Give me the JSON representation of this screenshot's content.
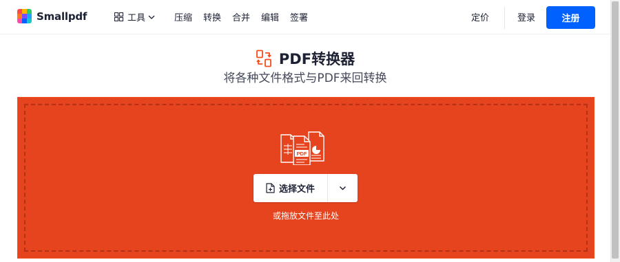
{
  "header": {
    "logo_text": "Smallpdf",
    "tools_label": "工具",
    "nav": [
      "压缩",
      "转换",
      "合并",
      "编辑",
      "签署"
    ],
    "pricing": "定价",
    "login": "登录",
    "signup": "注册"
  },
  "page": {
    "title": "PDF转换器",
    "subtitle": "将各种文件格式与PDF来回转换"
  },
  "dropzone": {
    "choose_label": "选择文件",
    "hint": "或拖放文件至此处",
    "pdf_badge": "PDF"
  },
  "colors": {
    "accent": "#0061fe",
    "dropzone": "#e5441f",
    "title_icon": "#f24e1e"
  },
  "icons": {
    "logo": "smallpdf-logo-icon",
    "tools": "grid-icon",
    "tools_chevron": "chevron-down-icon",
    "title": "convert-arrows-icon",
    "illustration": "files-icon",
    "choose": "add-file-icon",
    "more": "chevron-down-icon"
  }
}
